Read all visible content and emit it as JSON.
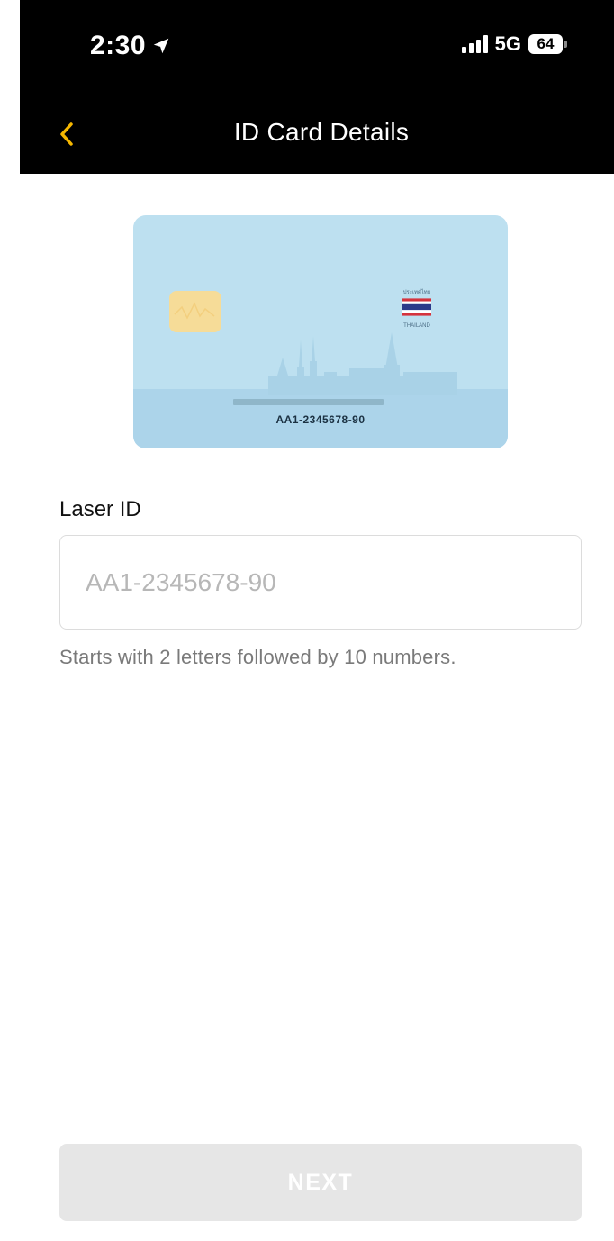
{
  "status_bar": {
    "time": "2:30",
    "network": "5G",
    "battery": "64",
    "icons": [
      "location-arrow-icon",
      "signal-bars-icon",
      "battery-icon"
    ]
  },
  "nav": {
    "title": "ID Card Details",
    "back_icon": "chevron-left-icon"
  },
  "card": {
    "country_label_top": "ประเทศไทย",
    "country_label_bottom": "THAILAND",
    "laser_id_sample": "AA1-2345678-90"
  },
  "form": {
    "label": "Laser ID",
    "placeholder": "AA1-2345678-90",
    "value": "",
    "helper": "Starts with 2 letters followed by 10 numbers."
  },
  "actions": {
    "next_label": "NEXT"
  },
  "colors": {
    "accent": "#F5B700",
    "bar": "#000000",
    "card": "#BDE0F0",
    "chip": "#F6DC98",
    "button_disabled": "#E6E6E6"
  }
}
